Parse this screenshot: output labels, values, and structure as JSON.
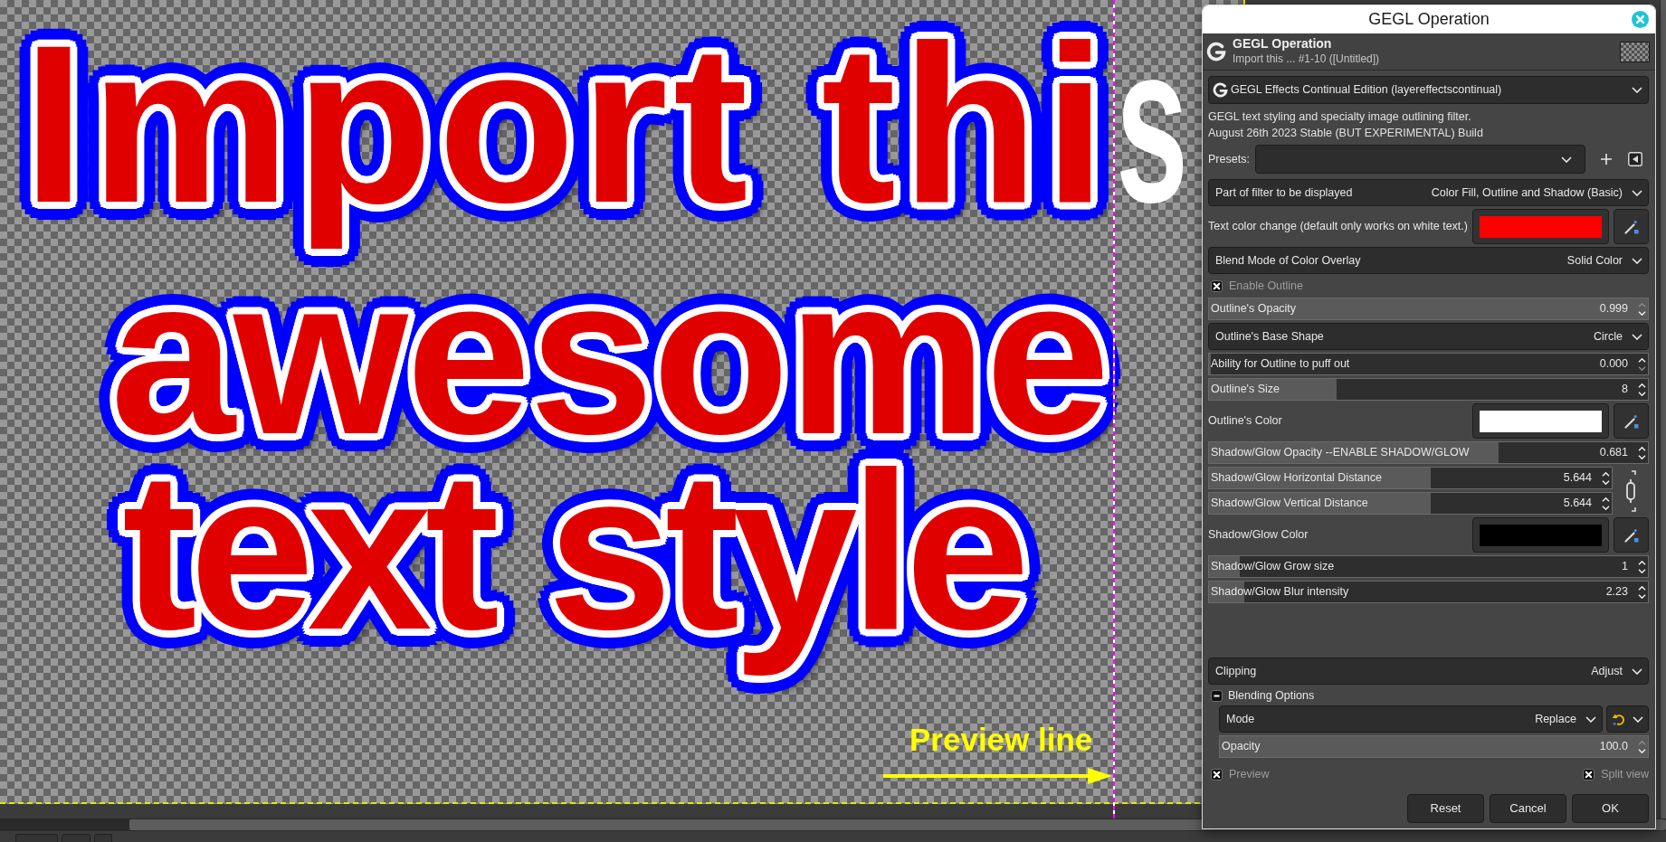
{
  "canvas": {
    "text_lines": [
      {
        "segments": [
          {
            "text": "Import thi",
            "filtered": true
          },
          {
            "text": "s",
            "filtered": false
          }
        ]
      },
      {
        "segments": [
          {
            "text": "awesome",
            "filtered": true
          }
        ]
      },
      {
        "segments": [
          {
            "text": "text style",
            "filtered": true
          }
        ]
      }
    ],
    "annotation": {
      "label": "Preview line"
    }
  },
  "dialog": {
    "title": "GEGL Operation",
    "header": {
      "title": "GEGL Operation",
      "subtitle": "Import this ... #1-10 ([Untitled])"
    },
    "operation": "GEGL Effects Continual Edition (layereffectscontinual)",
    "description": [
      "GEGL text styling and specialty image outlining filter.",
      "August 26th 2023 Stable (BUT EXPERIMENTAL) Build"
    ],
    "presets": {
      "label": "Presets:"
    },
    "controls": [
      {
        "kind": "dropdown",
        "label": "Part of filter to be displayed",
        "value": "Color Fill, Outline and Shadow (Basic)"
      },
      {
        "kind": "color",
        "label": "Text color change (default only works on white text.)",
        "color": "#ff0000"
      },
      {
        "kind": "dropdown",
        "label": "Blend Mode of Color Overlay",
        "value": "Solid Color"
      },
      {
        "kind": "checkbox",
        "label": "Enable Outline",
        "checked": true
      },
      {
        "kind": "slider",
        "label": "Outline's Opacity",
        "value": "0.999",
        "level": 1
      },
      {
        "kind": "dropdown",
        "label": "Outline's Base Shape",
        "value": "Circle"
      },
      {
        "kind": "slider",
        "label": "Ability for Outline to puff out",
        "value": "0.000",
        "level": 0
      },
      {
        "kind": "slider",
        "label": "Outline's Size",
        "value": "8",
        "level": 0.29
      },
      {
        "kind": "color",
        "label": "Outline's Color",
        "color": "#ffffff"
      },
      {
        "kind": "slider",
        "label": "Shadow/Glow Opacity --ENABLE SHADOW/GLOW",
        "value": "0.681",
        "level": 0.66
      },
      {
        "kind": "slider_pair",
        "linked": true,
        "sliders": [
          {
            "label": "Shadow/Glow Horizontal Distance",
            "value": "5.644",
            "level": 0.55
          },
          {
            "label": "Shadow/Glow Vertical Distance",
            "value": "5.644",
            "level": 0.55
          }
        ]
      },
      {
        "kind": "color",
        "label": "Shadow/Glow Color",
        "color": "#000000"
      },
      {
        "kind": "slider",
        "label": "Shadow/Glow Grow size",
        "value": "1",
        "level": 0.07
      },
      {
        "kind": "slider",
        "label": "Shadow/Glow Blur intensity",
        "value": "2.23",
        "level": 0.08
      }
    ],
    "clipping": {
      "label": "Clipping",
      "value": "Adjust"
    },
    "blending": {
      "label": "Blending Options",
      "expanded": true,
      "mode": {
        "label": "Mode",
        "value": "Replace"
      },
      "opacity": {
        "label": "Opacity",
        "value": "100.0",
        "level": 1
      }
    },
    "preview": {
      "label": "Preview",
      "checked": true
    },
    "split_view": {
      "label": "Split view",
      "checked": true
    },
    "buttons": [
      "Reset",
      "Cancel",
      "OK"
    ]
  }
}
